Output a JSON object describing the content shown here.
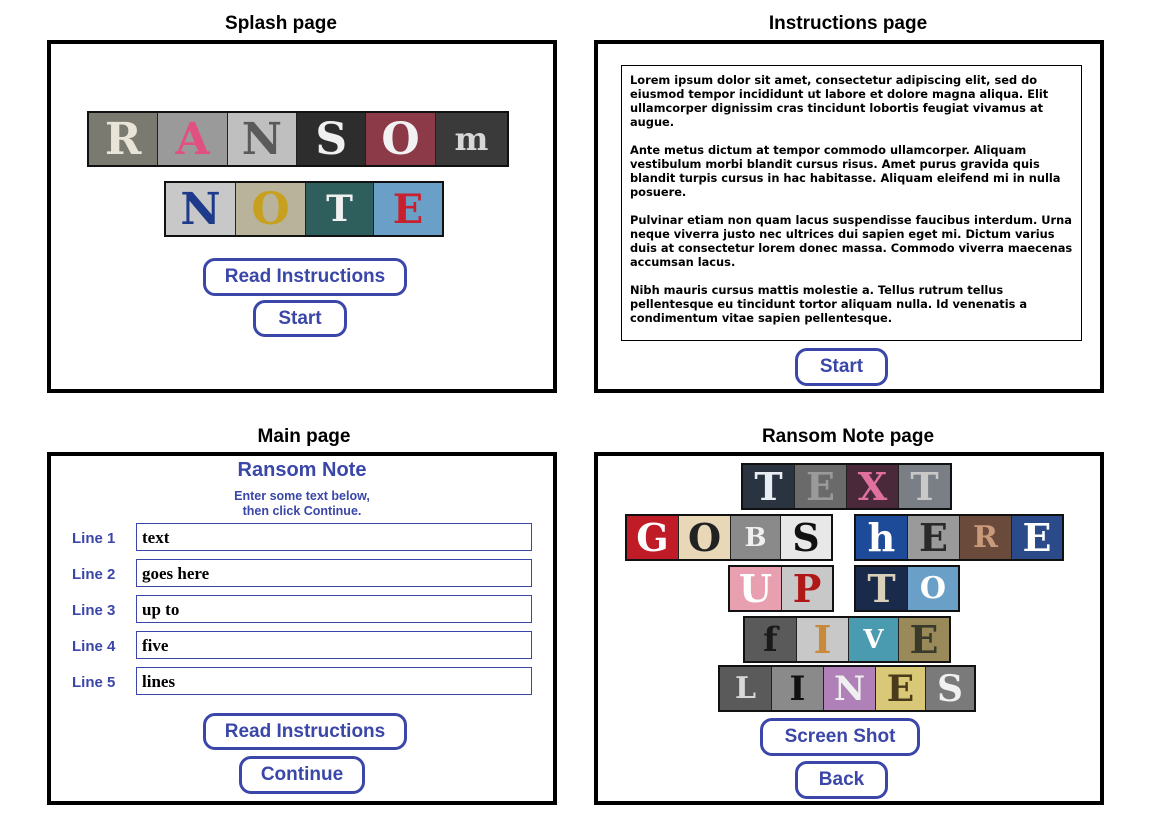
{
  "captions": {
    "splash": "Splash page",
    "instructions": "Instructions page",
    "main": "Main page",
    "ransom": "Ransom Note page"
  },
  "splash": {
    "word1": [
      "R",
      "A",
      "N",
      "S",
      "O",
      "m"
    ],
    "word2": [
      "N",
      "O",
      "T",
      "E"
    ],
    "read_instructions_label": "Read Instructions",
    "start_label": "Start"
  },
  "instructions": {
    "paragraphs": [
      "Lorem ipsum dolor sit amet, consectetur adipiscing elit, sed do eiusmod tempor incididunt ut labore et dolore magna aliqua. Elit ullamcorper dignissim cras tincidunt lobortis feugiat vivamus at augue.",
      "Ante metus dictum at tempor commodo ullamcorper. Aliquam vestibulum morbi blandit cursus risus. Amet purus gravida quis blandit turpis cursus in hac habitasse. Aliquam eleifend mi in nulla posuere.",
      "Pulvinar etiam non quam lacus suspendisse faucibus interdum. Urna neque viverra justo nec ultrices dui sapien eget mi. Dictum varius duis at consectetur lorem donec massa. Commodo viverra maecenas accumsan lacus.",
      "Nibh mauris cursus mattis molestie a. Tellus rutrum tellus pellentesque eu tincidunt tortor aliquam nulla. Id venenatis a condimentum vitae sapien pellentesque."
    ],
    "start_label": "Start"
  },
  "main": {
    "title": "Ransom Note",
    "subtitle_line1": "Enter some text below,",
    "subtitle_line2": "then click Continue.",
    "lines": [
      {
        "label": "Line 1",
        "value": "text"
      },
      {
        "label": "Line 2",
        "value": "goes here"
      },
      {
        "label": "Line 3",
        "value": "up to"
      },
      {
        "label": "Line 4",
        "value": "five"
      },
      {
        "label": "Line 5",
        "value": "lines"
      }
    ],
    "read_instructions_label": "Read Instructions",
    "continue_label": "Continue"
  },
  "ransom": {
    "rows": [
      [
        "T",
        "E",
        "X",
        "T"
      ],
      [
        "G",
        "O",
        "B",
        "S"
      ],
      [
        "h",
        "E",
        "R",
        "E"
      ],
      [
        "U",
        "P"
      ],
      [
        "T",
        "O"
      ],
      [
        "f",
        "I",
        "V",
        "E"
      ],
      [
        "L",
        "I",
        "N",
        "E",
        "S"
      ]
    ],
    "screenshot_label": "Screen Shot",
    "back_label": "Back"
  }
}
